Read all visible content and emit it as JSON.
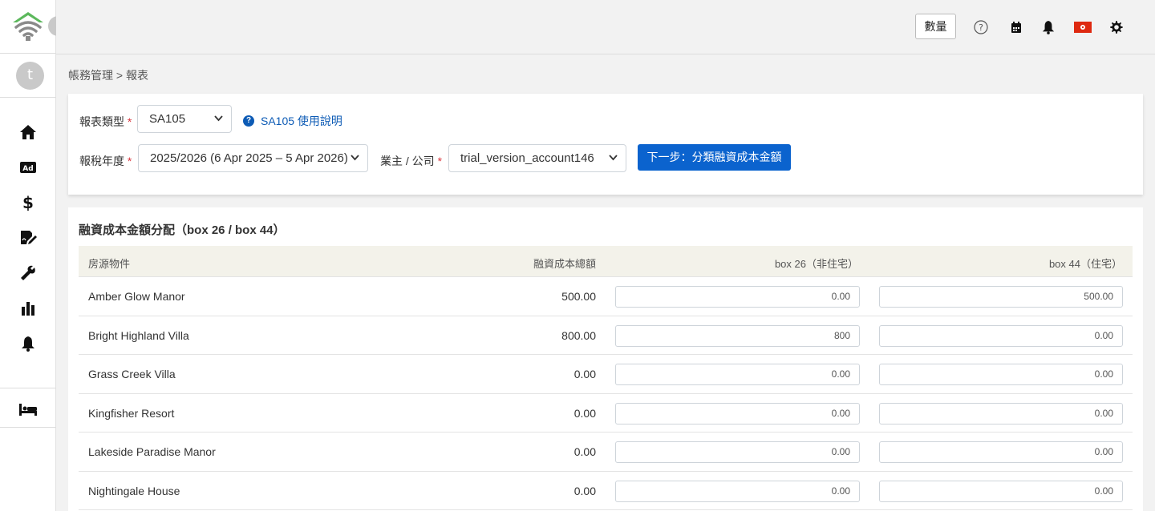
{
  "header": {
    "quantity_button": "數量",
    "icons": [
      "help-icon",
      "calendar-icon",
      "bell-icon",
      "hong-kong-flag-icon",
      "gear-icon"
    ]
  },
  "sidebar": {
    "avatar_initial": "t",
    "items": [
      "home-icon",
      "ad-icon",
      "dollar-icon",
      "signature-icon",
      "wrench-icon",
      "bar-chart-icon",
      "bell-icon",
      "bed-icon"
    ]
  },
  "breadcrumb": "帳務管理 > 報表",
  "filters": {
    "report_type_label": "報表類型",
    "report_type_value": "SA105",
    "help_link": "SA105 使用說明",
    "tax_year_label": "報稅年度",
    "tax_year_value": "2025/2026 (6 Apr 2025 – 5 Apr 2026)",
    "owner_label": "業主 / 公司",
    "owner_value": "trial_version_account146",
    "next_button": "下一步：分類融資成本金額"
  },
  "allocation": {
    "title": "融資成本金額分配（box 26 / box 44）",
    "columns": {
      "property": "房源物件",
      "total": "融資成本總額",
      "box26": "box 26（非住宅）",
      "box44": "box 44（住宅）"
    },
    "rows": [
      {
        "property": "Amber Glow Manor",
        "total": "500.00",
        "box26": "0.00",
        "box44": "500.00"
      },
      {
        "property": "Bright Highland Villa",
        "total": "800.00",
        "box26": "800",
        "box44": "0.00"
      },
      {
        "property": "Grass Creek Villa",
        "total": "0.00",
        "box26": "0.00",
        "box44": "0.00"
      },
      {
        "property": "Kingfisher Resort",
        "total": "0.00",
        "box26": "0.00",
        "box44": "0.00"
      },
      {
        "property": "Lakeside Paradise Manor",
        "total": "0.00",
        "box26": "0.00",
        "box44": "0.00"
      },
      {
        "property": "Nightingale House",
        "total": "0.00",
        "box26": "0.00",
        "box44": "0.00"
      }
    ]
  },
  "colors": {
    "primary_button": "#0b63ce",
    "link": "#0d5bb5",
    "required": "#d9363e",
    "table_header_bg": "#f3f2ea",
    "logo_green": "#5cb85c",
    "logo_gray": "#8a8a8a"
  }
}
